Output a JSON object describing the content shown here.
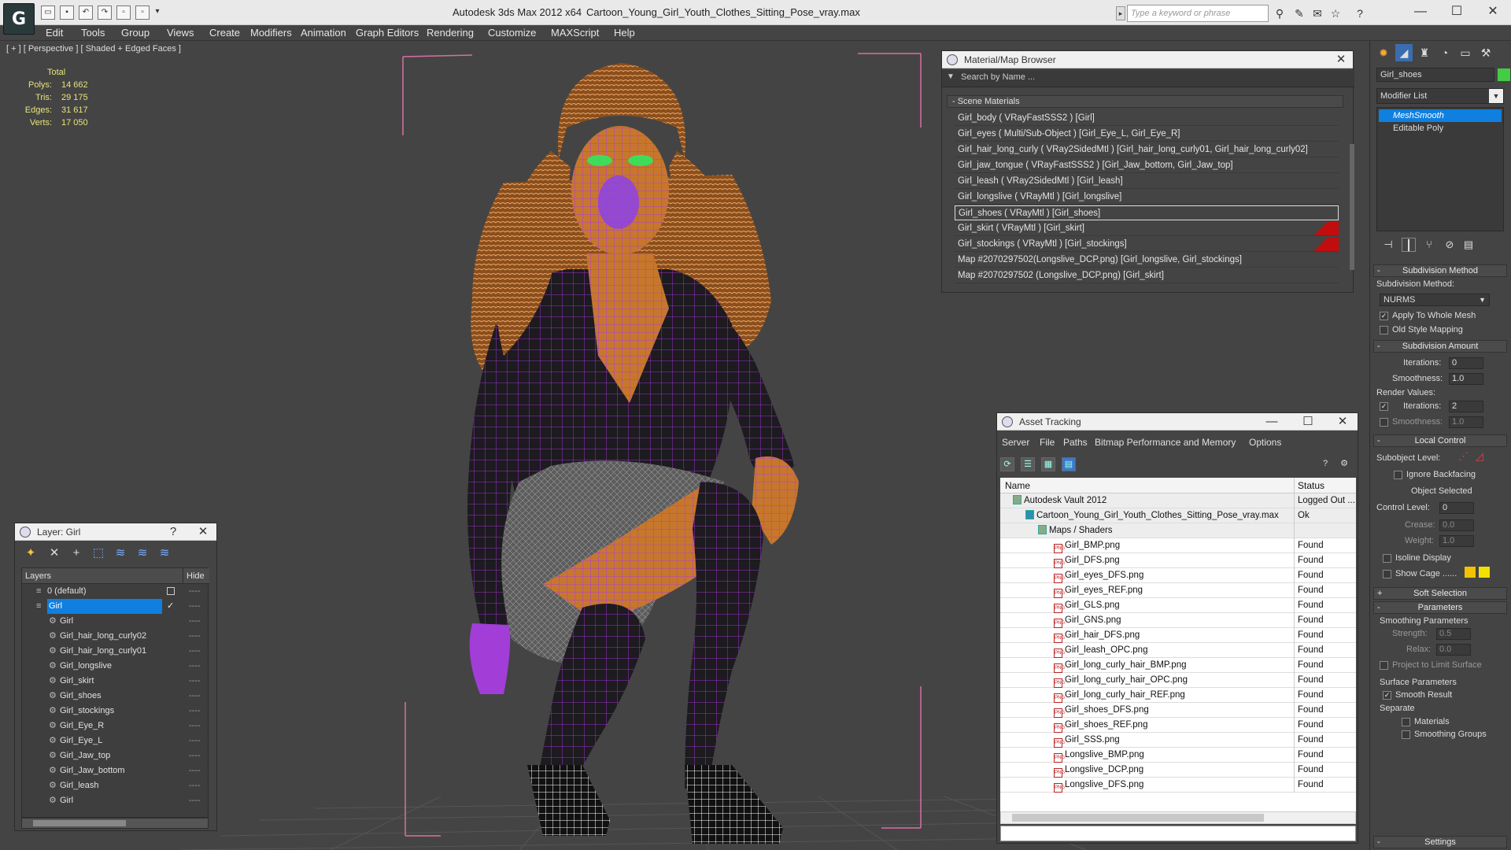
{
  "titlebar": {
    "app_title": "Autodesk 3ds Max  2012 x64",
    "file_title": "Cartoon_Young_Girl_Youth_Clothes_Sitting_Pose_vray.max",
    "search_placeholder": "Type a keyword or phrase",
    "logo_glyph": "G"
  },
  "menu": [
    "Edit",
    "Tools",
    "Group",
    "Views",
    "Create",
    "Modifiers",
    "Animation",
    "Graph Editors",
    "Rendering",
    "Customize",
    "MAXScript",
    "Help"
  ],
  "viewport": {
    "label": "[ + ] [ Perspective ] [ Shaded + Edged Faces ]",
    "stats": {
      "header": "Total",
      "rows": [
        {
          "label": "Polys:",
          "value": "14 662"
        },
        {
          "label": "Tris:",
          "value": "29 175"
        },
        {
          "label": "Edges:",
          "value": "31 617"
        },
        {
          "label": "Verts:",
          "value": "17 050"
        }
      ]
    }
  },
  "material_browser": {
    "title": "Material/Map Browser",
    "search": "Search by Name ...",
    "section": "- Scene Materials",
    "rows": [
      {
        "text": "Girl_body  ( VRayFastSSS2 ) [Girl]"
      },
      {
        "text": "Girl_eyes  ( Multi/Sub-Object ) [Girl_Eye_L, Girl_Eye_R]"
      },
      {
        "text": "Girl_hair_long_curly  ( VRay2SidedMtl ) [Girl_hair_long_curly01, Girl_hair_long_curly02]"
      },
      {
        "text": "Girl_jaw_tongue  ( VRayFastSSS2 ) [Girl_Jaw_bottom, Girl_Jaw_top]"
      },
      {
        "text": "Girl_leash  ( VRay2SidedMtl ) [Girl_leash]"
      },
      {
        "text": "Girl_longslive  ( VRayMtl ) [Girl_longslive]"
      },
      {
        "text": "Girl_shoes  ( VRayMtl ) [Girl_shoes]"
      },
      {
        "text": "Girl_skirt  ( VRayMtl ) [Girl_skirt]"
      },
      {
        "text": "Girl_stockings  ( VRayMtl ) [Girl_stockings]"
      },
      {
        "text": "Map #2070297502(Longslive_DCP.png) [Girl_longslive, Girl_stockings]"
      },
      {
        "text": "Map #2070297502 (Longslive_DCP.png) [Girl_skirt]"
      }
    ]
  },
  "asset_tracking": {
    "title": "Asset Tracking",
    "menu": [
      "Server",
      "File",
      "Paths",
      "Bitmap Performance and Memory",
      "Options"
    ],
    "col_name": "Name",
    "col_status": "Status",
    "rows": [
      {
        "name": "Autodesk Vault 2012",
        "status": "Logged Out ..."
      },
      {
        "name": "Cartoon_Young_Girl_Youth_Clothes_Sitting_Pose_vray.max",
        "status": "Ok"
      },
      {
        "name": "Maps / Shaders",
        "status": ""
      },
      {
        "name": "Girl_BMP.png",
        "status": "Found"
      },
      {
        "name": "Girl_DFS.png",
        "status": "Found"
      },
      {
        "name": "Girl_eyes_DFS.png",
        "status": "Found"
      },
      {
        "name": "Girl_eyes_REF.png",
        "status": "Found"
      },
      {
        "name": "Girl_GLS.png",
        "status": "Found"
      },
      {
        "name": "Girl_GNS.png",
        "status": "Found"
      },
      {
        "name": "Girl_hair_DFS.png",
        "status": "Found"
      },
      {
        "name": "Girl_leash_OPC.png",
        "status": "Found"
      },
      {
        "name": "Girl_long_curly_hair_BMP.png",
        "status": "Found"
      },
      {
        "name": "Girl_long_curly_hair_OPC.png",
        "status": "Found"
      },
      {
        "name": "Girl_long_curly_hair_REF.png",
        "status": "Found"
      },
      {
        "name": "Girl_shoes_DFS.png",
        "status": "Found"
      },
      {
        "name": "Girl_shoes_REF.png",
        "status": "Found"
      },
      {
        "name": "Girl_SSS.png",
        "status": "Found"
      },
      {
        "name": "Longslive_BMP.png",
        "status": "Found"
      },
      {
        "name": "Longslive_DCP.png",
        "status": "Found"
      },
      {
        "name": "Longslive_DFS.png",
        "status": "Found"
      }
    ]
  },
  "layer_manager": {
    "title": "Layer: Girl",
    "help": "?",
    "col_layers": "Layers",
    "col_hide": "Hide",
    "rows": [
      {
        "name": "0 (default)"
      },
      {
        "name": "Girl"
      },
      {
        "name": "Girl"
      },
      {
        "name": "Girl_hair_long_curly02"
      },
      {
        "name": "Girl_hair_long_curly01"
      },
      {
        "name": "Girl_longslive"
      },
      {
        "name": "Girl_skirt"
      },
      {
        "name": "Girl_shoes"
      },
      {
        "name": "Girl_stockings"
      },
      {
        "name": "Girl_Eye_R"
      },
      {
        "name": "Girl_Eye_L"
      },
      {
        "name": "Girl_Jaw_top"
      },
      {
        "name": "Girl_Jaw_bottom"
      },
      {
        "name": "Girl_leash"
      },
      {
        "name": "Girl"
      }
    ]
  },
  "command_panel": {
    "object_name": "Girl_shoes",
    "modifier_list": "Modifier List",
    "stack": [
      "MeshSmooth",
      "Editable Poly"
    ],
    "subdivision_method": {
      "header": "Subdivision Method",
      "label": "Subdivision Method:",
      "value": "NURMS",
      "apply_whole": "Apply To Whole Mesh",
      "old_style": "Old Style Mapping"
    },
    "subdivision_amount": {
      "header": "Subdivision Amount",
      "iterations_label": "Iterations:",
      "iterations": "0",
      "smoothness_label": "Smoothness:",
      "smoothness": "1.0",
      "render_values": "Render Values:",
      "r_iterations_label": "Iterations:",
      "r_iterations": "2",
      "r_smoothness_label": "Smoothness:",
      "r_smoothness": "1.0"
    },
    "local_control": {
      "header": "Local Control",
      "subobject_level": "Subobject Level:",
      "ignore_backfacing": "Ignore Backfacing",
      "object_selected": "Object Selected",
      "control_level_label": "Control Level:",
      "control_level": "0",
      "crease_label": "Crease:",
      "crease": "0.0",
      "weight_label": "Weight:",
      "weight": "1.0",
      "isoline": "Isoline Display",
      "show_cage": "Show Cage ......"
    },
    "soft_selection": "Soft Selection",
    "parameters": {
      "header": "Parameters",
      "smoothing": "Smoothing Parameters",
      "strength_label": "Strength:",
      "strength": "0.5",
      "relax_label": "Relax:",
      "relax": "0.0",
      "project": "Project to Limit Surface",
      "surface": "Surface Parameters",
      "smooth_result": "Smooth Result",
      "separate": "Separate",
      "materials": "Materials",
      "smoothing_groups": "Smoothing Groups"
    },
    "settings": "Settings"
  }
}
